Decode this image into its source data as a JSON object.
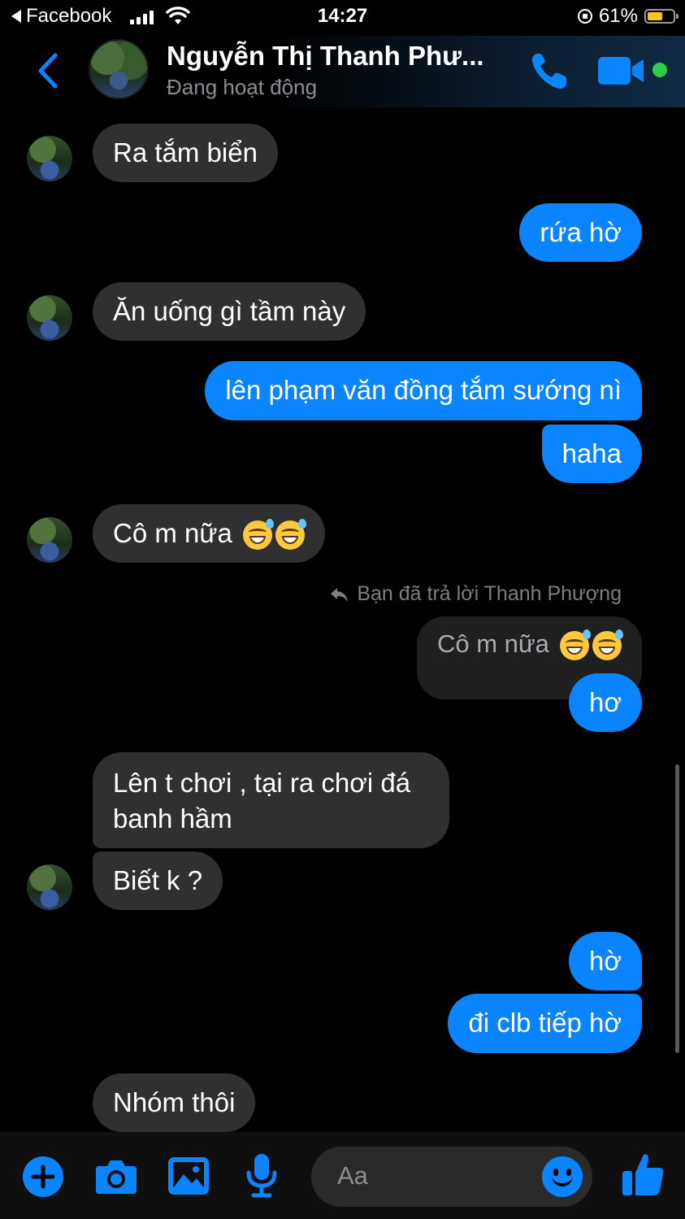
{
  "status_bar": {
    "back_app": "Facebook",
    "time": "14:27",
    "battery": "61%",
    "battery_level": 0.61
  },
  "header": {
    "name": "Nguyễn Thị Thanh Phư...",
    "status": "Đang hoạt động",
    "accent": "#0a84ff",
    "online_color": "#31cc46"
  },
  "messages": [
    {
      "side": "in",
      "text": "Ra tắm biển"
    },
    {
      "side": "out",
      "text": "rứa hờ"
    },
    {
      "side": "in",
      "text": "Ăn uống gì tầm này"
    },
    {
      "side": "out",
      "text": "lên phạm văn đồng tắm sướng nì"
    },
    {
      "side": "out",
      "text": "haha"
    },
    {
      "side": "in",
      "text": "Cô m nữa"
    },
    {
      "side": "out",
      "text": "hơ"
    },
    {
      "side": "in",
      "text": "Lên t chơi , tại ra chơi đá"
    },
    {
      "side": "in",
      "text": "banh hầm"
    },
    {
      "side": "in",
      "text": "Biết k ?"
    },
    {
      "side": "out",
      "text": "hờ"
    },
    {
      "side": "out",
      "text": "đi clb tiếp hờ"
    },
    {
      "side": "in",
      "text": "Nhóm thôi"
    }
  ],
  "reply": {
    "note": "Bạn đã trả lời Thanh Phượng",
    "quoted_text": "Cô m nữa"
  },
  "composer": {
    "placeholder": "Aa"
  },
  "icons": [
    "back-chevron-icon",
    "phone-icon",
    "video-camera-icon",
    "plus-icon",
    "camera-icon",
    "image-icon",
    "microphone-icon",
    "emoji-icon",
    "thumbs-up-icon"
  ]
}
